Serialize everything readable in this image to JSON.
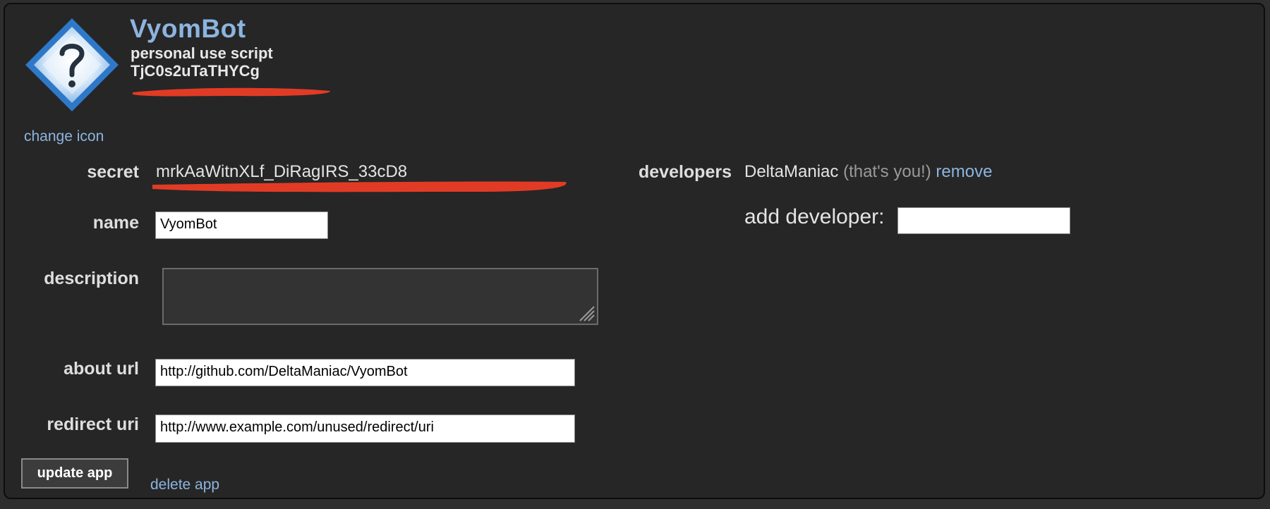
{
  "app": {
    "name": "VyomBot",
    "type": "personal use script",
    "id": "TjC0s2uTaTHYCg",
    "change_icon_label": "change icon"
  },
  "form": {
    "secret_label": "secret",
    "secret_value": "mrkAaWitnXLf_DiRagIRS_33cD8",
    "name_label": "name",
    "name_value": "VyomBot",
    "description_label": "description",
    "description_value": "",
    "about_url_label": "about url",
    "about_url_value": "http://github.com/DeltaManiac/VyomBot",
    "redirect_uri_label": "redirect uri",
    "redirect_uri_value": "http://www.example.com/unused/redirect/uri",
    "update_label": "update app",
    "delete_label": "delete app"
  },
  "developers": {
    "label": "developers",
    "name": "DeltaManiac",
    "you_note": "(that's you!)",
    "remove_label": "remove",
    "add_label": "add developer:",
    "add_value": ""
  },
  "icons": {
    "app_icon": "question-mark-diamond-icon",
    "resize_grip": "resize-grip-icon"
  },
  "colors": {
    "accent_link": "#8db4e0",
    "background": "#262626",
    "redaction": "#e23b25"
  }
}
